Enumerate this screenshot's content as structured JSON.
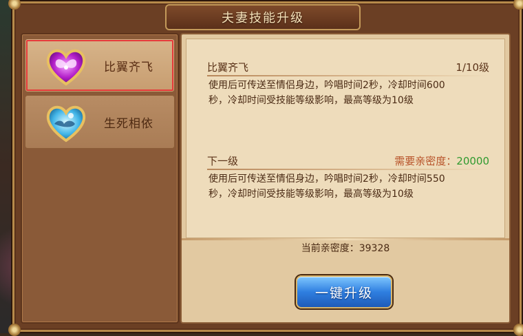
{
  "window": {
    "title": "夫妻技能升级"
  },
  "skills": [
    {
      "name": "比翼齐飞",
      "selected": true,
      "icon": "purple-heart-wings-icon"
    },
    {
      "name": "生死相依",
      "selected": false,
      "icon": "blue-heart-clouds-icon"
    }
  ],
  "current": {
    "name": "比翼齐飞",
    "level": "1/10级",
    "description_line1": "使用后可传送至情侣身边，吟唱时间2秒，冷却时间600",
    "description_line2": "秒，冷却时间受技能等级影响，最高等级为10级"
  },
  "next": {
    "label": "下一级",
    "requirement_label": "需要亲密度：",
    "requirement_value": "20000",
    "description_line1": "使用后可传送至情侣身边，吟唱时间2秒，冷却时间550",
    "description_line2": "秒，冷却时间受技能等级影响，最高等级为10级"
  },
  "intimacy": {
    "text": "当前亲密度：39328"
  },
  "buttons": {
    "upgrade": "一键升级"
  },
  "colors": {
    "selection_outline": "#e53a3a",
    "requirement_value": "#2f9a2f",
    "requirement_label": "#b8532a",
    "button_blue": "#2f7fe0"
  }
}
